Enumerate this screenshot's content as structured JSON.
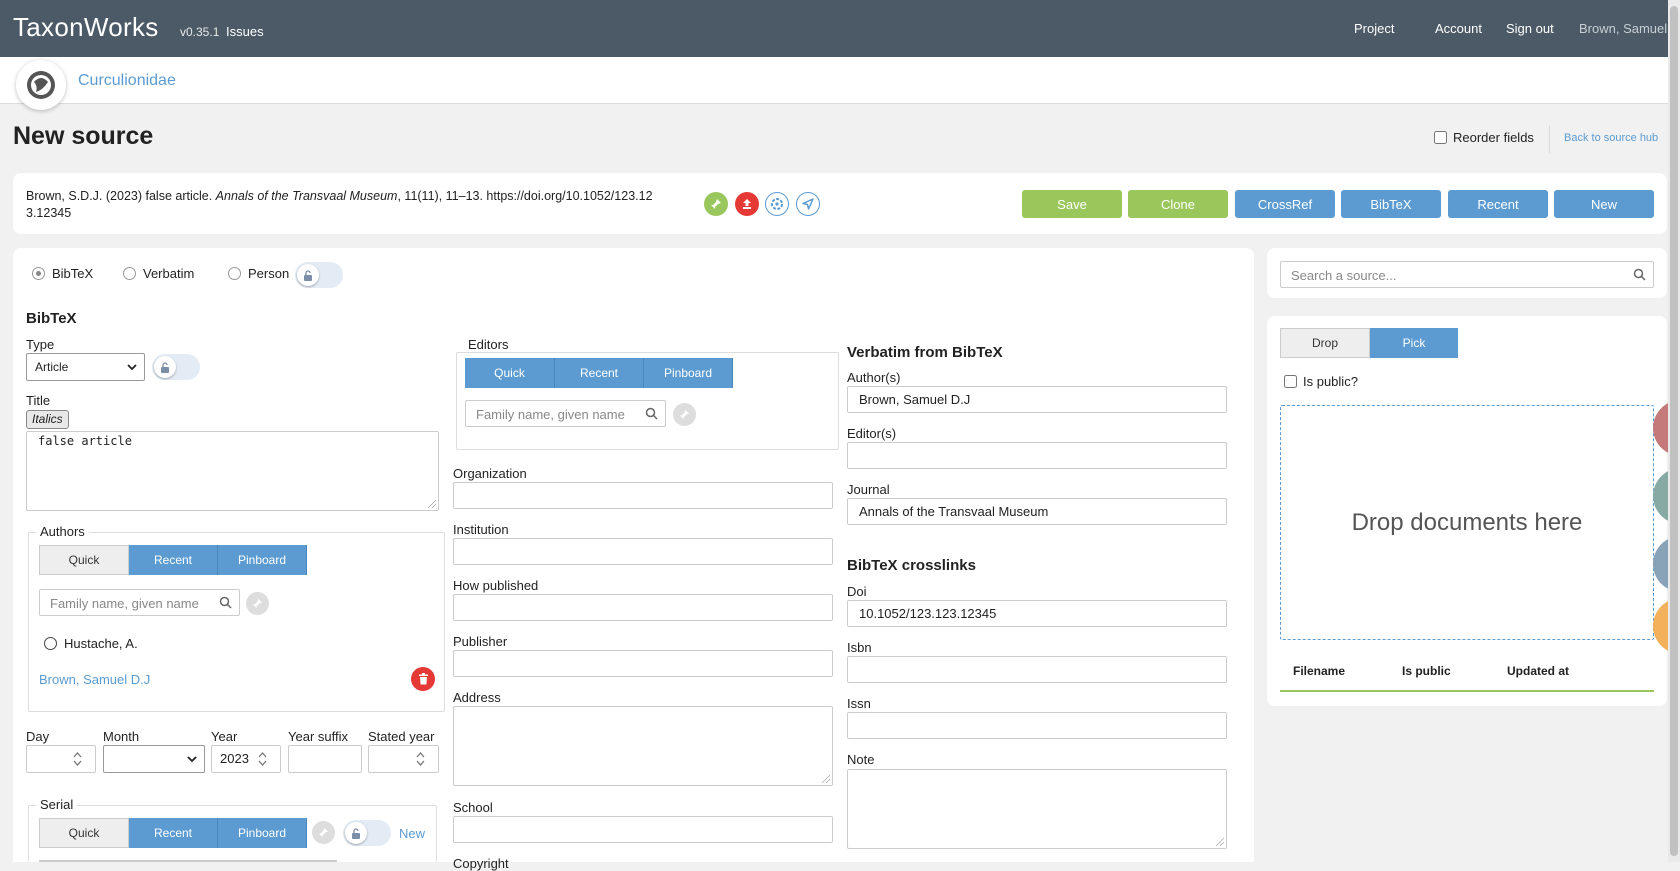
{
  "header": {
    "brand": "TaxonWorks",
    "version": "v0.35.1",
    "issues": "Issues",
    "nav": [
      "Project",
      "Account",
      "Sign out"
    ],
    "user": "Brown, Samuel"
  },
  "project": {
    "name": "Curculionidae"
  },
  "page": {
    "title": "New source",
    "reorder_label": "Reorder fields",
    "back_link": "Back to source hub"
  },
  "citation": {
    "before": "Brown, S.D.J. (2023) false article. ",
    "journal_italic": "Annals of the Transvaal Museum",
    "after": ", 11(11), 11–13. https://doi.org/10.1052/123.12 3.12345"
  },
  "toolbar": [
    "Save",
    "Clone",
    "CrossRef",
    "BibTeX",
    "Recent",
    "New"
  ],
  "source_type": {
    "options": [
      "BibTeX",
      "Verbatim",
      "Person"
    ],
    "selected": "BibTeX"
  },
  "bibtex": {
    "heading": "BibTeX",
    "type_label": "Type",
    "type_value": "Article",
    "title_label": "Title",
    "italics_button": "Italics",
    "title_value": "false article",
    "authors_legend": "Authors",
    "author_tabs": [
      "Quick",
      "Recent",
      "Pinboard"
    ],
    "author_search_placeholder": "Family name, given name",
    "author_option": "Hustache, A.",
    "author_added": "Brown, Samuel D.J",
    "date_labels": [
      "Day",
      "Month",
      "Year",
      "Year suffix",
      "Stated year"
    ],
    "year_value": "2023",
    "serial_legend": "Serial",
    "serial_tabs": [
      "Quick",
      "Recent",
      "Pinboard"
    ],
    "serial_new": "New"
  },
  "middle": {
    "editors_legend": "Editors",
    "editor_tabs": [
      "Quick",
      "Recent",
      "Pinboard"
    ],
    "editor_search_placeholder": "Family name, given name",
    "fields": [
      "Organization",
      "Institution",
      "How published",
      "Publisher",
      "Address",
      "School",
      "Copyright"
    ]
  },
  "verbatim": {
    "heading": "Verbatim from BibTeX",
    "authors_label": "Author(s)",
    "authors_value": "Brown, Samuel D.J",
    "editors_label": "Editor(s)",
    "journal_label": "Journal",
    "journal_value": "Annals of the Transvaal Museum",
    "crosslinks_heading": "BibTeX crosslinks",
    "doi_label": "Doi",
    "doi_value": "10.1052/123.123.12345",
    "isbn_label": "Isbn",
    "issn_label": "Issn",
    "note_label": "Note"
  },
  "sidebar": {
    "search_placeholder": "Search a source...",
    "toggle": [
      "Drop",
      "Pick"
    ],
    "toggle_active": "Pick",
    "is_public_label": "Is public?",
    "dropzone_text": "Drop documents here",
    "table_headers": [
      "Filename",
      "Is public",
      "Updated at"
    ]
  },
  "colors": {
    "primary": "#5b9bd1",
    "success": "#9ac75c",
    "danger": "#e53935",
    "header": "#4b5a66"
  }
}
